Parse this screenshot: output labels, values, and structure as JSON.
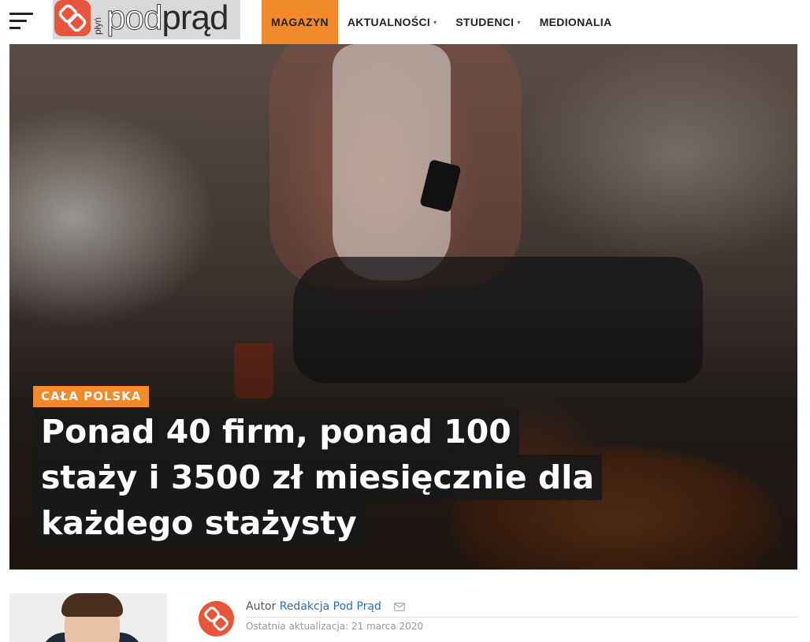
{
  "header": {
    "logo": {
      "small_text": "płyń",
      "text_pod": "pod",
      "text_prad": "prąd"
    },
    "nav": [
      {
        "label": "MAGAZYN",
        "active": true,
        "has_dropdown": false
      },
      {
        "label": "AKTUALNOŚCI",
        "active": false,
        "has_dropdown": true
      },
      {
        "label": "STUDENCI",
        "active": false,
        "has_dropdown": true
      },
      {
        "label": "MEDIONALIA",
        "active": false,
        "has_dropdown": false
      }
    ],
    "caret": "▾"
  },
  "hero": {
    "category": "CAŁA POLSKA",
    "headline_lines": [
      "Ponad 40 firm, ponad 100",
      "staży i 3500 zł miesięcznie dla",
      "każdego stażysty"
    ]
  },
  "author": {
    "prefix": "Autor",
    "name": "Redakcja Pod Prąd",
    "updated": "Ostatnia aktualizacja: 21 marca 2020"
  },
  "colors": {
    "accent": "#f18a2b",
    "link": "#2a6fb5"
  },
  "icons": [
    "menu-icon",
    "mail-icon",
    "logo-mark-icon"
  ]
}
